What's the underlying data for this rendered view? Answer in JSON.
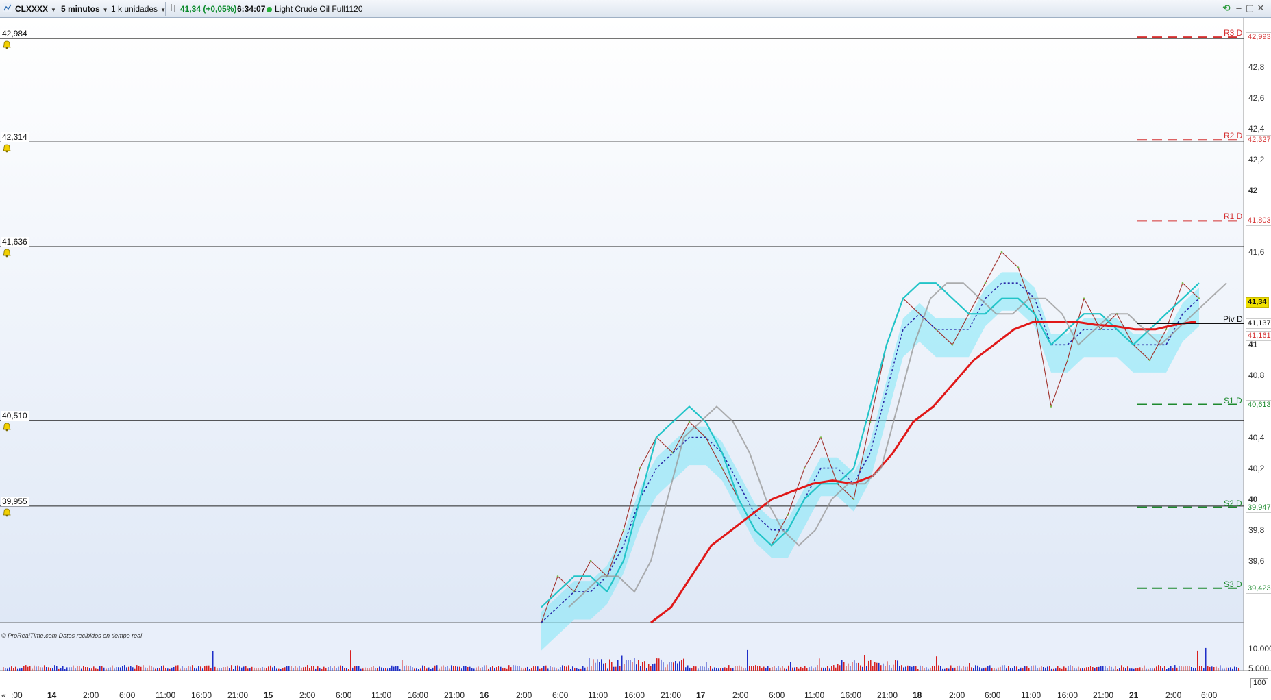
{
  "toolbar": {
    "symbol": "CLXXXX",
    "timeframe": "5 minutos",
    "units": "1 k unidades",
    "last_price": "41,34 (+0,05%)",
    "time": "6:34:07",
    "instrument": "Light Crude Oil Full1120"
  },
  "price_levels": [
    {
      "label": "42,984",
      "price": 42.984
    },
    {
      "label": "42,314",
      "price": 42.314
    },
    {
      "label": "41,636",
      "price": 41.636
    },
    {
      "label": "40,510",
      "price": 40.51
    },
    {
      "label": "39,955",
      "price": 39.955
    }
  ],
  "pivots": [
    {
      "name": "R3 D",
      "value": "42,993",
      "price": 42.993,
      "color": "#d43030"
    },
    {
      "name": "R2 D",
      "value": "42,327",
      "price": 42.327,
      "color": "#d43030"
    },
    {
      "name": "R1 D",
      "value": "41,803",
      "price": 41.803,
      "color": "#d43030"
    },
    {
      "name": "Piv D",
      "value": "41,137",
      "price": 41.137,
      "color": "#111111"
    },
    {
      "name": "S1 D",
      "value": "40,613",
      "price": 40.613,
      "color": "#1e8a2e"
    },
    {
      "name": "S2 D",
      "value": "39,947",
      "price": 39.947,
      "color": "#1e8a2e"
    },
    {
      "name": "S3 D",
      "value": "39,423",
      "price": 39.423,
      "color": "#1e8a2e"
    }
  ],
  "current_price": {
    "label": "41,34",
    "price": 41.34
  },
  "extra_price_tag": {
    "label": "41,161",
    "price": 41.161
  },
  "y_axis_labels": [
    "42,8",
    "42,6",
    "42,4",
    "42,2",
    "42",
    "41,6",
    "41",
    "40,8",
    "40,4",
    "40,2",
    "40",
    "39,8",
    "39,6"
  ],
  "x_axis_labels": [
    ":00",
    "14",
    "2:00",
    "6:00",
    "11:00",
    "16:00",
    "21:00",
    "15",
    "2:00",
    "6:00",
    "11:00",
    "16:00",
    "21:00",
    "16",
    "2:00",
    "6:00",
    "11:00",
    "16:00",
    "21:00",
    "17",
    "2:00",
    "6:00",
    "11:00",
    "16:00",
    "21:00",
    "18",
    "2:00",
    "6:00",
    "11:00",
    "16:00",
    "21:00",
    "21",
    "2:00",
    "6:00"
  ],
  "volume_axis": [
    "10.000",
    "5.000"
  ],
  "volume_box": "100",
  "copyright": "© ProRealTime.com  Datos recibidos en tiempo real",
  "nav_button": "«",
  "colors": {
    "price_line": "#a0302a",
    "ma_fast": "#2a2aa8",
    "ma_cyan": "#22c4c8",
    "ma_red": "#e01818",
    "ma_gray": "#9a9a9a",
    "cloud": "#7fe8f8"
  },
  "chart_data": {
    "type": "line",
    "title": "",
    "ylabel": "",
    "xlabel": "",
    "ylim": [
      39.2,
      43.1
    ],
    "series": [
      {
        "values": [
          39.2,
          39.5,
          39.4,
          39.6,
          39.5,
          39.8,
          40.2,
          40.4,
          40.3,
          40.5,
          40.4,
          40.2,
          40.0,
          39.8,
          39.7,
          39.9,
          40.2,
          40.4,
          40.1,
          40.0,
          40.5,
          41.0,
          41.3,
          41.2,
          41.1,
          41.0,
          41.2,
          41.4,
          41.6,
          41.5,
          41.2,
          40.6,
          40.9,
          41.3,
          41.1,
          41.2,
          41.0,
          40.9,
          41.1,
          41.4,
          41.3
        ]
      },
      {
        "values": [
          39.2,
          39.3,
          39.4,
          39.4,
          39.5,
          39.7,
          40.0,
          40.2,
          40.3,
          40.4,
          40.4,
          40.3,
          40.1,
          39.9,
          39.8,
          39.8,
          40.0,
          40.2,
          40.2,
          40.1,
          40.3,
          40.7,
          41.1,
          41.2,
          41.1,
          41.1,
          41.1,
          41.3,
          41.4,
          41.4,
          41.3,
          41.0,
          41.0,
          41.1,
          41.1,
          41.1,
          41.0,
          41.0,
          41.0,
          41.2,
          41.3
        ]
      },
      {
        "values": [
          39.3,
          39.4,
          39.5,
          39.5,
          39.4,
          39.6,
          40.0,
          40.4,
          40.5,
          40.6,
          40.5,
          40.3,
          40.0,
          39.8,
          39.7,
          39.8,
          40.0,
          40.1,
          40.1,
          40.2,
          40.6,
          41.0,
          41.3,
          41.4,
          41.4,
          41.3,
          41.2,
          41.2,
          41.3,
          41.3,
          41.2,
          41.0,
          41.1,
          41.2,
          41.2,
          41.1,
          41.0,
          41.1,
          41.2,
          41.3,
          41.4
        ]
      },
      {
        "values": [
          39.2,
          39.3,
          39.5,
          39.7,
          39.8,
          39.9,
          40.0,
          40.05,
          40.1,
          40.12,
          40.1,
          40.15,
          40.3,
          40.5,
          40.6,
          40.75,
          40.9,
          41.0,
          41.1,
          41.15,
          41.15,
          41.15,
          41.13,
          41.12,
          41.1,
          41.1,
          41.13,
          41.15
        ]
      }
    ]
  }
}
